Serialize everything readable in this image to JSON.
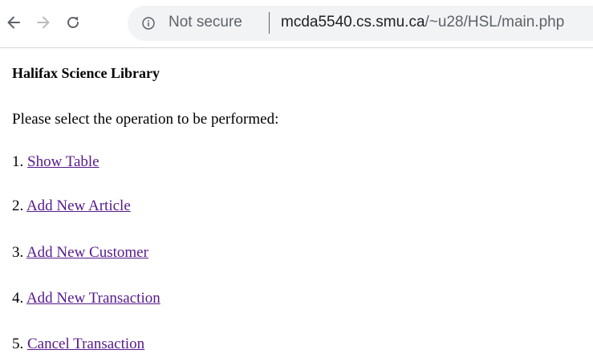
{
  "browser": {
    "security_label": "Not secure",
    "url_host": "mcda5540.cs.smu.ca",
    "url_path": "/~u28/HSL/main.php"
  },
  "page": {
    "title": "Halifax Science Library",
    "prompt": "Please select the operation to be performed:",
    "menu": [
      {
        "number": "1.",
        "label": "Show Table"
      },
      {
        "number": "2.",
        "label": "Add New Article"
      },
      {
        "number": "3.",
        "label": "Add New Customer"
      },
      {
        "number": "4.",
        "label": "Add New Transaction"
      },
      {
        "number": "5.",
        "label": "Cancel Transaction"
      }
    ]
  },
  "colors": {
    "visited_link": "#551a8b",
    "omnibox_bg": "#f1f3f4",
    "icon_gray": "#5f6368"
  },
  "icons": [
    "back-arrow-icon",
    "forward-arrow-icon",
    "reload-icon",
    "info-icon"
  ]
}
